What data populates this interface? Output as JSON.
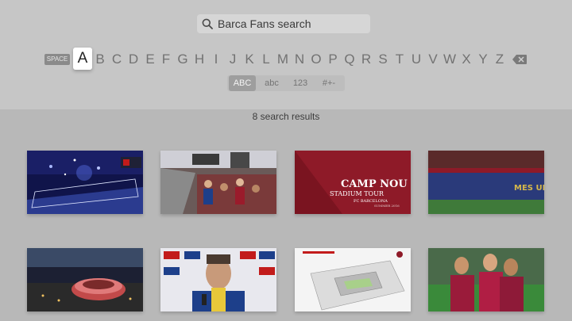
{
  "search": {
    "query": "Barca Fans search"
  },
  "keyboard": {
    "space_label": "SPACE",
    "letters": [
      "A",
      "B",
      "C",
      "D",
      "E",
      "F",
      "G",
      "H",
      "I",
      "J",
      "K",
      "L",
      "M",
      "N",
      "O",
      "P",
      "Q",
      "R",
      "S",
      "T",
      "U",
      "V",
      "W",
      "X",
      "Y",
      "Z"
    ],
    "delete_icon": "backspace-icon"
  },
  "modes": {
    "upper": "ABC",
    "lower": "abc",
    "numbers": "123",
    "symbols": "#+-"
  },
  "results": {
    "count_label": "8 search results",
    "thumb3_title": "CAMP NOU",
    "thumb3_subtitle": "STADIUM TOUR",
    "thumb3_brand": "FC BARCELONA",
    "thumb3_season": "SUMMER 2016",
    "thumb4_banner": "MES UN"
  },
  "colors": {
    "background": "#b8b8b8",
    "top_panel": "#c6c6c6",
    "focus_key": "#ffffff"
  }
}
